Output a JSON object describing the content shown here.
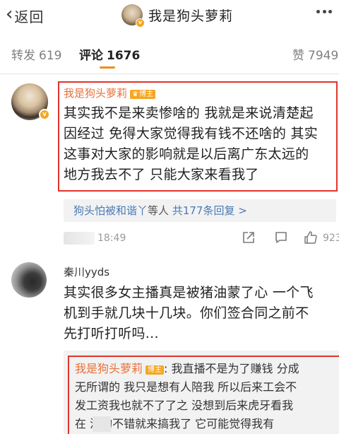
{
  "topbar": {
    "back_label": "返回",
    "title": "我是狗头萝莉",
    "title_badge": "v"
  },
  "tabs": {
    "forward_label": "转发",
    "forward_count": "619",
    "comment_label": "评论",
    "comment_count": "1676",
    "like_label": "赞",
    "like_count": "7949"
  },
  "comment1": {
    "username": "我是狗头萝莉",
    "badge": "博主",
    "badge_icon": "crown-icon",
    "avatar_badge": "v",
    "lines": [
      "其实我不是来卖惨啥的 我就是来说清楚起",
      "因经过 免得大家觉得我有钱不还啥的 其实",
      "这事对大家的影响就是以后离广东太远的",
      "地方我去不了 只能大家来看我了"
    ],
    "replies_names": "狗头怕被和谐丫",
    "replies_mid": "等人",
    "replies_total": "共177条回复 >",
    "time": "18:49",
    "like_count": "923",
    "highlight_color": "#e0342b"
  },
  "comment2": {
    "username": "秦川yyds",
    "lines": [
      "其实很多女主播真是被猪油蒙了心 一个飞",
      "机到手就几块十几块。你们签合同之前不",
      "先打听打听吗..."
    ],
    "reply": {
      "author": "我是狗头萝莉",
      "badge": "博主",
      "lines": [
        ": 我直播不是为了赚钱 分成",
        "无所谓的 我只是想有人陪我 所以后来工会不",
        "发工资我也就不了了之 没想到后来虎牙看我",
        "在  混的不错就来搞我了 它可能觉得我有"
      ]
    }
  },
  "colors": {
    "accent_orange": "#f08c1c",
    "username_orange": "#e8703a",
    "link_blue": "#4a7ab5",
    "annotation_red": "#e0342b"
  }
}
